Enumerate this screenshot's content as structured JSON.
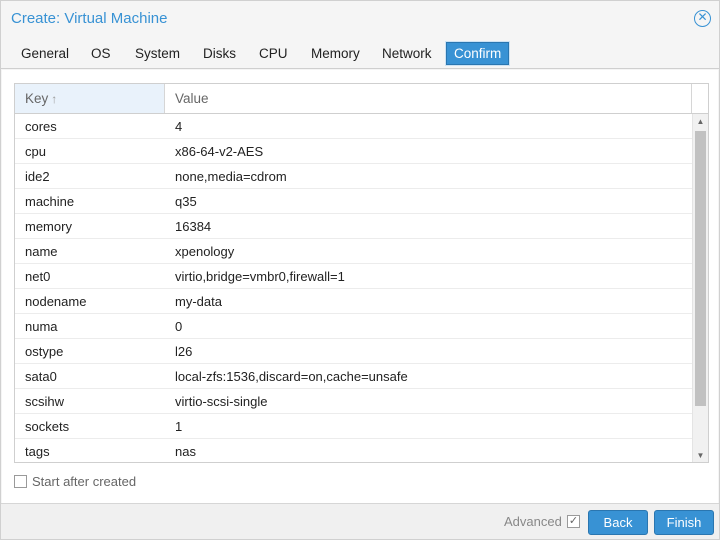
{
  "dialog": {
    "title": "Create: Virtual Machine",
    "close_icon": "close-circle-icon"
  },
  "tabs": [
    {
      "label": "General"
    },
    {
      "label": "OS"
    },
    {
      "label": "System"
    },
    {
      "label": "Disks"
    },
    {
      "label": "CPU"
    },
    {
      "label": "Memory"
    },
    {
      "label": "Network"
    },
    {
      "label": "Confirm",
      "active": true
    }
  ],
  "grid": {
    "columns": {
      "key": "Key",
      "value": "Value"
    },
    "sort_icon": "arrow-up-icon",
    "rows": [
      {
        "key": "cores",
        "value": "4"
      },
      {
        "key": "cpu",
        "value": "x86-64-v2-AES"
      },
      {
        "key": "ide2",
        "value": "none,media=cdrom"
      },
      {
        "key": "machine",
        "value": "q35"
      },
      {
        "key": "memory",
        "value": "16384"
      },
      {
        "key": "name",
        "value": "xpenology"
      },
      {
        "key": "net0",
        "value": "virtio,bridge=vmbr0,firewall=1"
      },
      {
        "key": "nodename",
        "value": "my-data"
      },
      {
        "key": "numa",
        "value": "0"
      },
      {
        "key": "ostype",
        "value": "l26"
      },
      {
        "key": "sata0",
        "value": "local-zfs:1536,discard=on,cache=unsafe"
      },
      {
        "key": "scsihw",
        "value": "virtio-scsi-single"
      },
      {
        "key": "sockets",
        "value": "1"
      },
      {
        "key": "tags",
        "value": "nas"
      }
    ]
  },
  "start_after_created": {
    "label": "Start after created",
    "checked": false
  },
  "footer": {
    "advanced_label": "Advanced",
    "advanced_checked": true,
    "back_label": "Back",
    "finish_label": "Finish"
  },
  "colors": {
    "accent": "#3892d4",
    "header_key_bg": "#e9f2fb"
  }
}
